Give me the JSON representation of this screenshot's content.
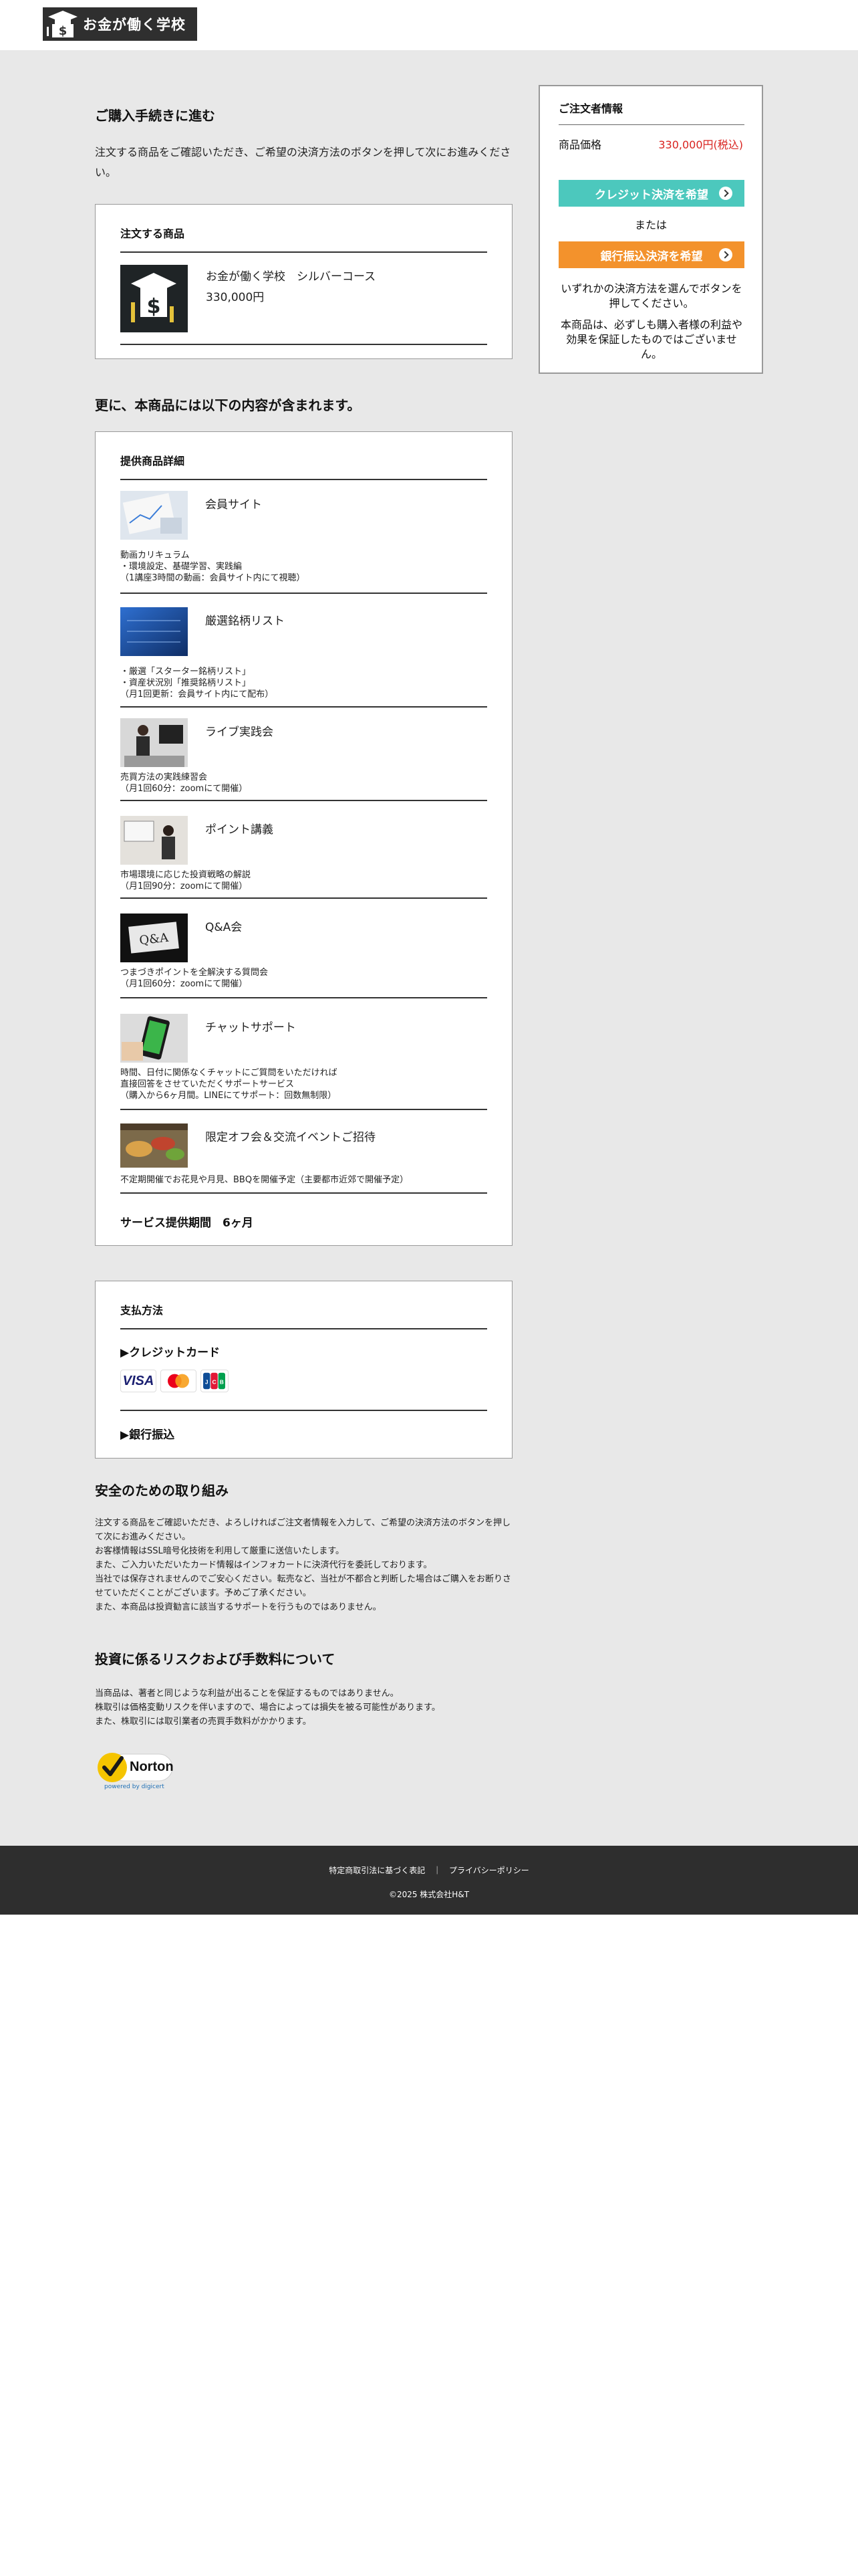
{
  "header": {
    "logo_text": "お金が働く学校"
  },
  "purchase": {
    "heading": "ご購入手続きに進む",
    "intro": "注文する商品をご確認いただき、ご希望の決済方法のボタンを押して次にお進みください。"
  },
  "order": {
    "title": "注文する商品",
    "product_name": "お金が働く学校　シルバーコース",
    "product_price": "330,000円"
  },
  "includes": {
    "heading": "更に、本商品には以下の内容が含まれます。",
    "title": "提供商品詳細",
    "items": [
      {
        "title": "会員サイト",
        "desc": "動画カリキュラム\n・環境設定、基礎学習、実践編\n（1講座3時間の動画：会員サイト内にて視聴）"
      },
      {
        "title": "厳選銘柄リスト",
        "desc": "・厳選「スターター銘柄リスト」\n・資産状況別「推奨銘柄リスト」\n（月1回更新：会員サイト内にて配布）"
      },
      {
        "title": "ライブ実践会",
        "desc": "売買方法の実践練習会\n（月1回60分：zoomにて開催）"
      },
      {
        "title": "ポイント講義",
        "desc": "市場環境に応じた投資戦略の解説\n（月1回90分：zoomにて開催）"
      },
      {
        "title": "Q&A会",
        "desc": "つまづきポイントを全解決する質問会\n（月1回60分：zoomにて開催）"
      },
      {
        "title": "チャットサポート",
        "desc": "時間、日付に関係なくチャットにご質問をいただければ\n直接回答をさせていただくサポートサービス\n（購入から6ヶ月間。LINEにてサポート：回数無制限）"
      },
      {
        "title": "限定オフ会＆交流イベントご招待",
        "desc": "不定期開催でお花見や月見、BBQを開催予定（主要都市近郊で開催予定）"
      }
    ],
    "service_period": "サービス提供期間　6ヶ月"
  },
  "payment": {
    "title": "支払方法",
    "credit_label": "▶クレジットカード",
    "bank_label": "▶銀行振込",
    "cards": [
      "VISA",
      "MasterCard",
      "JCB"
    ]
  },
  "safety": {
    "heading": "安全のための取り組み",
    "lines": [
      "注文する商品をご確認いただき、よろしければご注文者情報を入力して、ご希望の決済方法のボタンを押して次にお進みください。",
      "お客様情報はSSL暗号化技術を利用して厳重に送信いたします。",
      "また、ご入力いただいたカード情報はインフォカートに決済代行を委託しております。",
      "当社では保存されませんのでご安心ください。転売など、当社が不都合と判断した場合はご購入をお断りさせていただくことがございます。予めご了承ください。",
      "また、本商品は投資勧言に該当するサポートを行うものではありません。"
    ]
  },
  "risk": {
    "heading": "投資に係るリスクおよび手数料について",
    "lines": [
      "当商品は、著者と同じような利益が出ることを保証するものではありません。",
      "株取引は価格変動リスクを伴いますので、場合によっては損失を被る可能性があります。",
      "また、株取引には取引業者の売買手数料がかかります。"
    ]
  },
  "norton": {
    "brand": "Norton",
    "powered": "powered by digicert"
  },
  "sidebar": {
    "title": "ご注文者情報",
    "price_label": "商品価格",
    "price_value": "330,000円(税込)",
    "credit_button": "クレジット決済を希望",
    "or_text": "または",
    "bank_button": "銀行振込決済を希望",
    "note1": "いずれかの決済方法を選んでボタンを押してください。",
    "note2": "本商品は、必ずしも購入者様の利益や効果を保証したものではございません。"
  },
  "footer": {
    "link1": "特定商取引法に基づく表記",
    "separator": "｜",
    "link2": "プライバシーポリシー",
    "copyright": "©2025 株式会社H&T"
  }
}
